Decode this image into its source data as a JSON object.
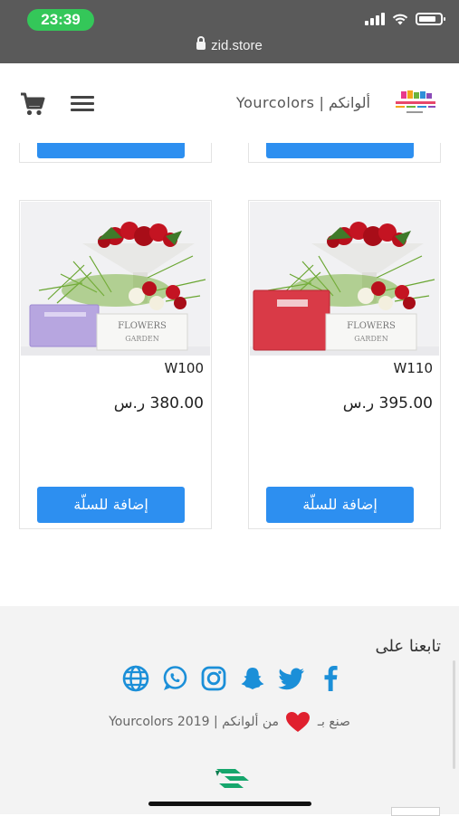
{
  "status_bar": {
    "time": "23:39",
    "url": "zid.store"
  },
  "header": {
    "store_title": "ألوانكم | Yourcolors",
    "logo_icon": "store-logo-icon",
    "menu_icon": "hamburger-menu-icon",
    "cart_icon": "shopping-cart-icon"
  },
  "products": [
    {
      "name": "W110",
      "price": "395.00 ر.س",
      "add_label": "إضافة للسلّة"
    },
    {
      "name": "W100",
      "price": "380.00 ر.س",
      "add_label": "إضافة للسلّة"
    }
  ],
  "footer": {
    "follow_title": "تابعنا على",
    "social_icons": [
      "facebook-icon",
      "twitter-icon",
      "snapchat-icon",
      "instagram-icon",
      "whatsapp-icon",
      "globe-icon"
    ],
    "made_with_prefix": "صنع بـ",
    "made_with_suffix": "من ألوانكم | Yourcolors 2019"
  },
  "colors": {
    "accent": "#2d8ff0",
    "status_green": "#34c759",
    "social_blue": "#1b8fd8",
    "heart_red": "#e0202e",
    "zid_green": "#16a66c"
  }
}
